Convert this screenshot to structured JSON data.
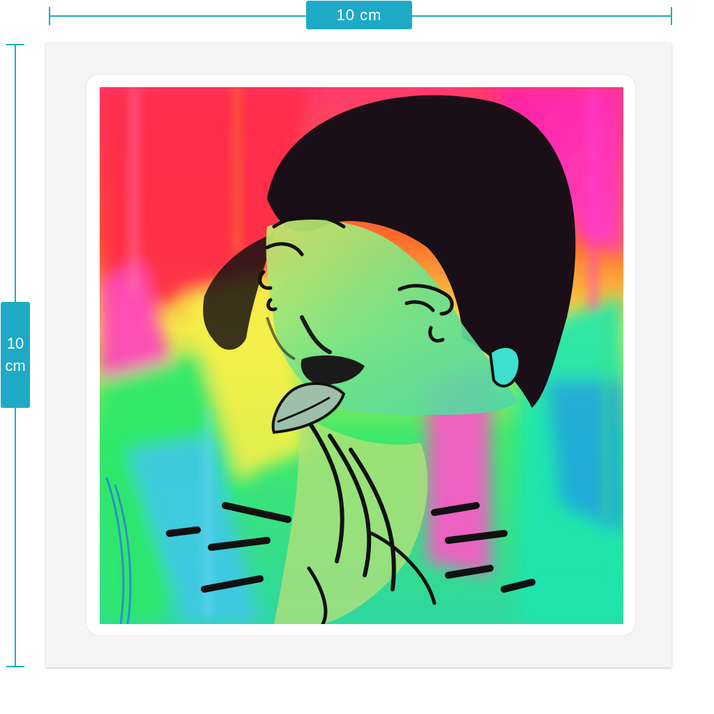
{
  "dimensions": {
    "width_label": "10 cm",
    "height_value": "10",
    "height_unit": "cm"
  },
  "colors": {
    "dimension_accent": "#1eaac6",
    "card_background": "#f5f5f5"
  }
}
